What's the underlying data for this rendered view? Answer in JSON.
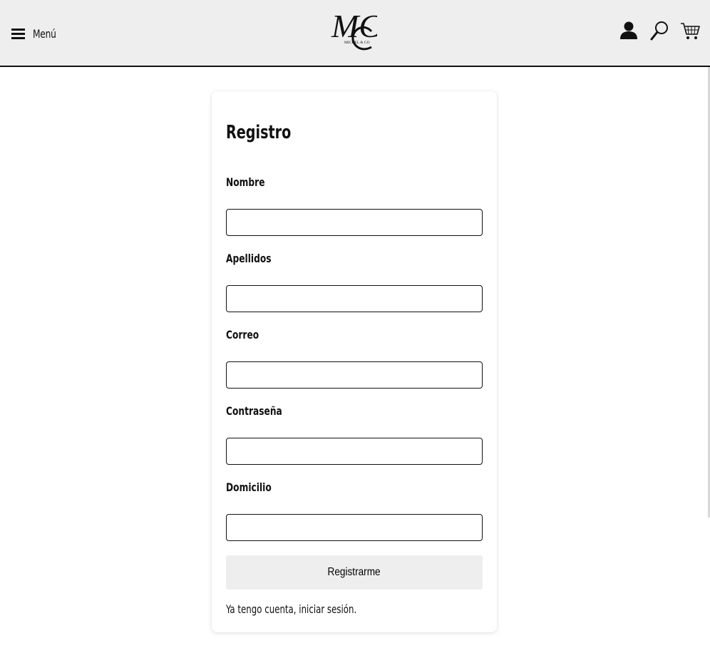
{
  "header": {
    "menu_label": "Menú",
    "logo_monogram": "MC",
    "logo_subtext": "MICHEL & CO",
    "icons": [
      "user-icon",
      "search-icon",
      "cart-icon"
    ]
  },
  "form": {
    "title": "Registro",
    "fields": [
      {
        "label": "Nombre",
        "value": ""
      },
      {
        "label": "Apellidos",
        "value": ""
      },
      {
        "label": "Correo",
        "value": ""
      },
      {
        "label": "Contraseña",
        "value": ""
      },
      {
        "label": "Domicilio",
        "value": ""
      }
    ],
    "submit_label": "Registrarme",
    "login_link": "Ya tengo cuenta, iniciar sesión."
  },
  "colors": {
    "header_bg": "#eeeeee",
    "button_bg": "#eeeeee",
    "text": "#111111",
    "page_bg": "#ffffff"
  }
}
